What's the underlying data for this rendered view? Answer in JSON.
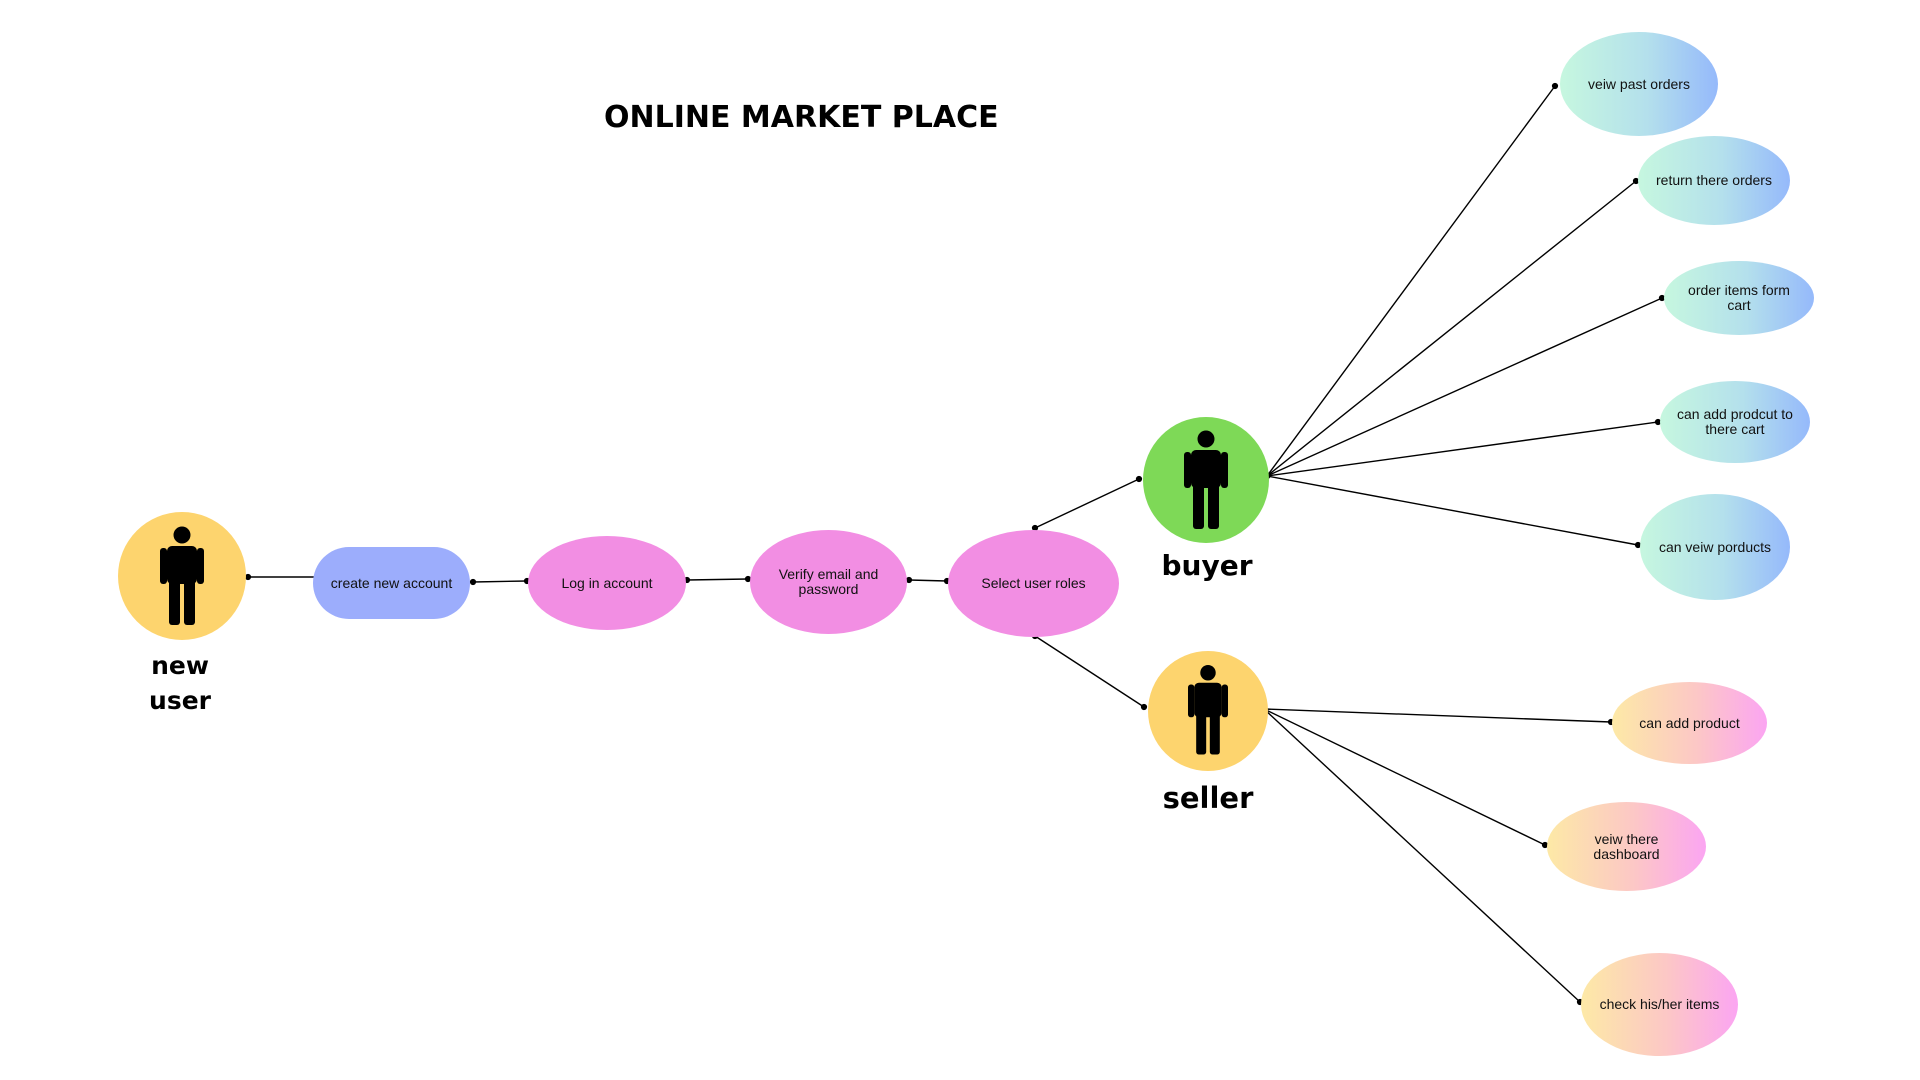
{
  "title": "ONLINE MARKET PLACE",
  "colors": {
    "new_user_circle": "#fdd46e",
    "buyer_circle": "#7ed957",
    "seller_circle": "#fdd46e",
    "create_account": "#9cadfc",
    "flow_nodes": "#f28ee3",
    "buyer_gradient": [
      "#c6f7df",
      "#95b9fb"
    ],
    "seller_gradient": [
      "#fde9a6",
      "#fba5f2"
    ],
    "connector": "#000000"
  },
  "actors": {
    "new_user": {
      "label_line1": "new",
      "label_line2": "user",
      "icon": "person-icon"
    },
    "buyer": {
      "label": "buyer",
      "icon": "person-icon"
    },
    "seller": {
      "label": "seller",
      "icon": "person-icon"
    }
  },
  "flow": {
    "create_account": "create new account",
    "log_in": "Log in account",
    "verify": "Verify email and password",
    "select_roles": "Select user roles"
  },
  "buyer_actions": [
    "veiw past orders",
    "return there orders",
    "order items form cart",
    "can add prodcut to there cart",
    "can veiw porducts"
  ],
  "seller_actions": [
    "can add product",
    "veiw there dashboard",
    "check his/her items"
  ]
}
